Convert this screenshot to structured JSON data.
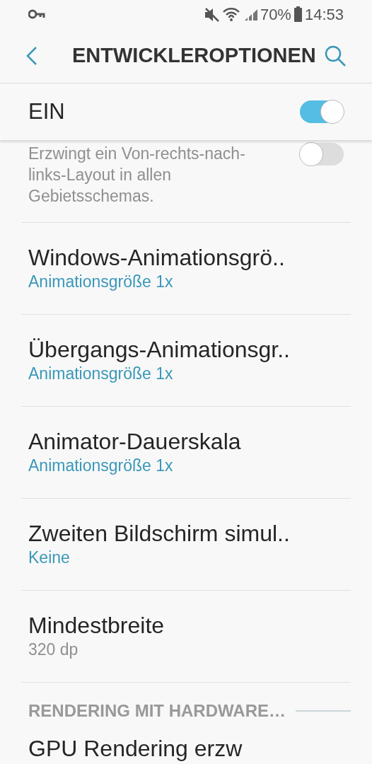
{
  "status_bar": {
    "battery": "70%",
    "time": "14:53"
  },
  "header": {
    "title": "ENTWICKLEROPTIONEN"
  },
  "master_switch": {
    "label": "EIN",
    "on": true
  },
  "settings": [
    {
      "kind": "toggle",
      "summary": "Erzwingt ein Von-rechts-nach-links-Layout in allen Gebietsschemas.",
      "on": false
    },
    {
      "kind": "value",
      "title": "Windows-Animationsgrö..",
      "value": "Animationsgröße 1x"
    },
    {
      "kind": "value",
      "title": "Übergangs-Animationsgr..",
      "value": "Animationsgröße 1x"
    },
    {
      "kind": "value",
      "title": "Animator-Dauerskala",
      "value": "Animationsgröße 1x"
    },
    {
      "kind": "value",
      "title": "Zweiten Bildschirm simul..",
      "value": "Keine"
    },
    {
      "kind": "summary",
      "title": "Mindestbreite",
      "value": "320 dp"
    }
  ],
  "section": {
    "title": "RENDERING MIT HARDWARE…",
    "items": [
      {
        "title": "GPU Rendering erzw"
      }
    ]
  }
}
